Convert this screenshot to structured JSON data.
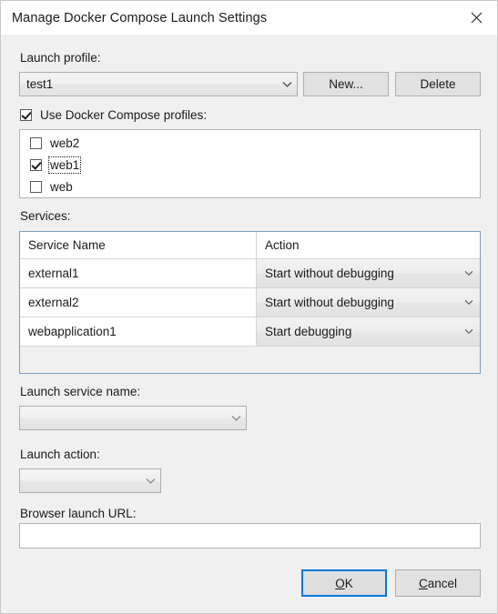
{
  "window": {
    "title": "Manage Docker Compose Launch Settings",
    "close_icon": "close-icon"
  },
  "launch_profile": {
    "label": "Launch profile:",
    "selected": "test1",
    "new_button": "New...",
    "delete_button": "Delete"
  },
  "compose_profiles": {
    "label": "Use Docker Compose profiles:",
    "checked": true,
    "items": [
      {
        "label": "web2",
        "checked": false,
        "focused": false
      },
      {
        "label": "web1",
        "checked": true,
        "focused": true
      },
      {
        "label": "web",
        "checked": false,
        "focused": false
      }
    ]
  },
  "services": {
    "label": "Services:",
    "columns": [
      "Service Name",
      "Action"
    ],
    "rows": [
      {
        "name": "external1",
        "action": "Start without debugging"
      },
      {
        "name": "external2",
        "action": "Start without debugging"
      },
      {
        "name": "webapplication1",
        "action": "Start debugging"
      }
    ]
  },
  "launch_service_name": {
    "label": "Launch service name:",
    "selected": ""
  },
  "launch_action": {
    "label": "Launch action:",
    "selected": ""
  },
  "browser_launch_url": {
    "label": "Browser launch URL:",
    "value": "",
    "placeholder": ""
  },
  "footer": {
    "ok_prefix": "",
    "ok_accel": "O",
    "ok_suffix": "K",
    "cancel_accel": "C",
    "cancel_suffix": "ancel"
  },
  "colors": {
    "dialog_bg": "#f0f0f0",
    "titlebar_bg": "#ffffff",
    "accent": "#0078d7",
    "grid_border": "#7b9ebd",
    "text": "#1b1b1b"
  }
}
